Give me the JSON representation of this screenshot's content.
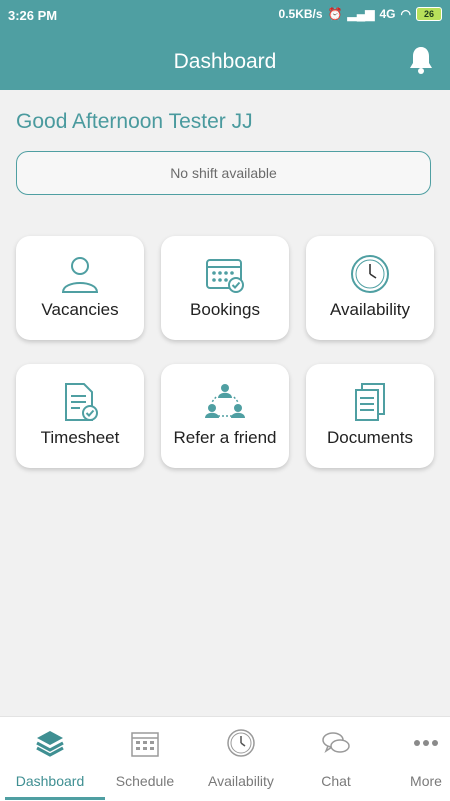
{
  "status": {
    "time": "3:26 PM",
    "speed": "0.5KB/s",
    "network": "4G",
    "battery": "26"
  },
  "appbar": {
    "title": "Dashboard"
  },
  "greeting": "Good Afternoon Tester JJ",
  "shift": {
    "message": "No shift available"
  },
  "tiles": [
    {
      "label": "Vacancies",
      "icon": "person-icon"
    },
    {
      "label": "Bookings",
      "icon": "calendar-check-icon"
    },
    {
      "label": "Availability",
      "icon": "clock-icon"
    },
    {
      "label": "Timesheet",
      "icon": "timesheet-icon"
    },
    {
      "label": "Refer a friend",
      "icon": "refer-icon"
    },
    {
      "label": "Documents",
      "icon": "documents-icon"
    }
  ],
  "nav": [
    {
      "label": "Dashboard",
      "icon": "layers-icon",
      "active": true
    },
    {
      "label": "Schedule",
      "icon": "calendar-icon"
    },
    {
      "label": "Availability",
      "icon": "clock-icon"
    },
    {
      "label": "Chat",
      "icon": "chat-icon"
    },
    {
      "label": "More",
      "icon": "more-dots-icon"
    }
  ],
  "colors": {
    "primary": "#4f9fa2",
    "greeting": "#4a9a9e",
    "background": "#f1f1f1"
  }
}
